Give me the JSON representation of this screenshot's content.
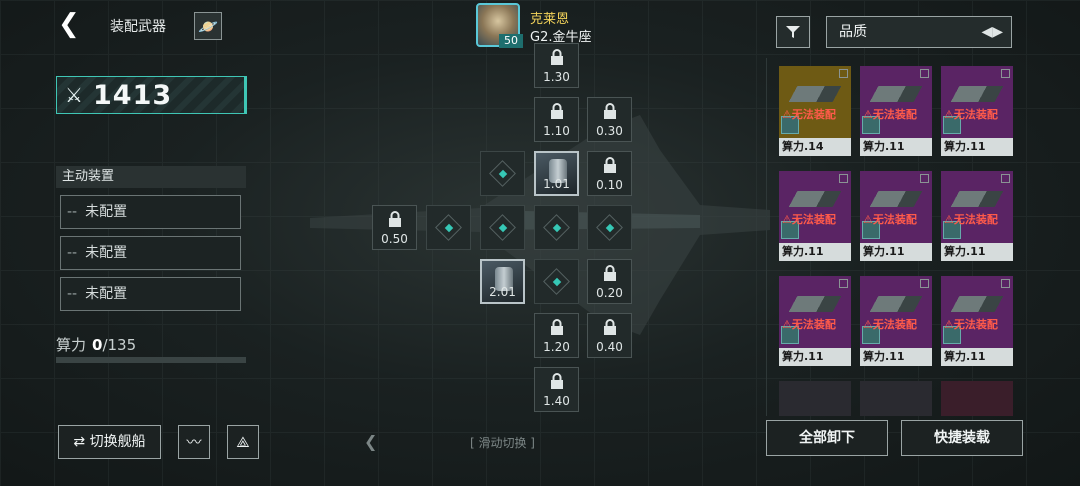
{
  "header": {
    "back_icon": "chevron-left-icon",
    "title": "装配武器",
    "planet_icon": "planet-icon"
  },
  "power": {
    "icon": "crossed-swords-icon",
    "value": "1413"
  },
  "active_devices": {
    "title": "主动装置",
    "slots": [
      {
        "dash": "--",
        "label": "未配置"
      },
      {
        "dash": "--",
        "label": "未配置"
      },
      {
        "dash": "--",
        "label": "未配置"
      }
    ]
  },
  "compute": {
    "label": "算力",
    "used": "0",
    "max": "/135"
  },
  "bottom_left": {
    "switch_label": "⇄ 切换舰船",
    "wave_icon": "waveform-icon",
    "fleet_icon": "fleet-icon"
  },
  "swipe": {
    "arrow": "❮",
    "label": "[ 滑动切换 ]"
  },
  "pilot": {
    "name": "克莱恩",
    "level": "50",
    "ship": "G2.金牛座"
  },
  "grid": {
    "c1": "1.30",
    "c2": "1.10",
    "c3": "0.30",
    "c4": "1.01",
    "c5": "0.10",
    "c6": "0.50",
    "c7": "2.01",
    "c8": "0.20",
    "c9": "1.20",
    "c10": "0.40",
    "c11": "1.40"
  },
  "filter": {
    "icon": "filter-icon",
    "sort_label": "品质",
    "sort_icon": "sort-toggle-icon"
  },
  "cards": [
    {
      "warn": "⚠无法装配",
      "foot": "算力.14",
      "color": "#6e5a14"
    },
    {
      "warn": "⚠无法装配",
      "foot": "算力.11",
      "color": "#5a2464"
    },
    {
      "warn": "⚠无法装配",
      "foot": "算力.11",
      "color": "#5a2464"
    },
    {
      "warn": "⚠无法装配",
      "foot": "算力.11",
      "color": "#5a2464"
    },
    {
      "warn": "⚠无法装配",
      "foot": "算力.11",
      "color": "#5a2464"
    },
    {
      "warn": "⚠无法装配",
      "foot": "算力.11",
      "color": "#5a2464"
    },
    {
      "warn": "⚠无法装配",
      "foot": "算力.11",
      "color": "#5a2464"
    },
    {
      "warn": "⚠无法装配",
      "foot": "算力.11",
      "color": "#5a2464"
    },
    {
      "warn": "⚠无法装配",
      "foot": "算力.11",
      "color": "#5a2464"
    }
  ],
  "actions": {
    "unequip_all": "全部卸下",
    "quick_equip": "快捷装载"
  },
  "colors": {
    "accent": "#3fc6b5",
    "warn": "#ff5a4a",
    "epic": "#5a2464",
    "legend": "#6e5a14"
  }
}
